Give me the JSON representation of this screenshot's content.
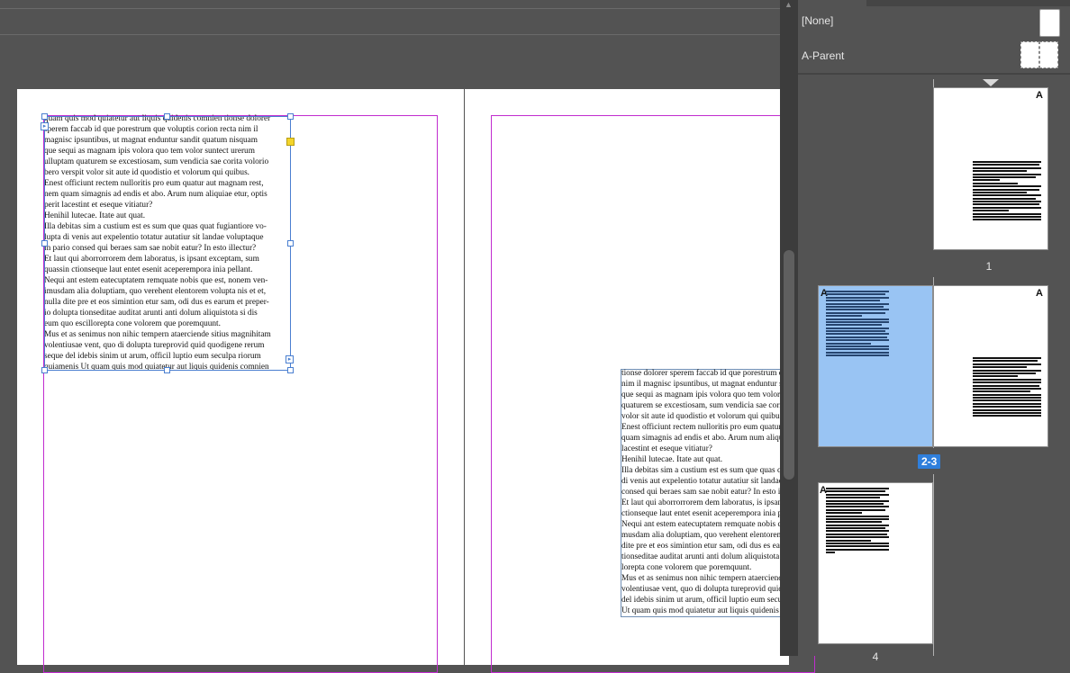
{
  "document": {
    "left_frame_lines": [
      "quam quis mod quiatetur aut liquis quidenis comnien tionse dolorer",
      "sperem faccab id que porestrum que voluptis corion recta nim il",
      "magnisc ipsuntibus, ut magnat enduntur sandit quatum nisquam",
      "que sequi as magnam ipis volora quo tem volor suntect urerum",
      "ulluptam quaturem se excestiosam, sum vendicia sae corita volorio",
      "bero verspit volor sit aute id quodistio et volorum qui quibus.",
      "Enest officiunt rectem nulloritis pro eum quatur aut magnam rest,",
      "nem quam simagnis ad endis et abo. Arum num aliquiae etur, optis",
      "perit lacestint et eseque vitiatur?",
      "Henihil lutecae. Itate aut quat.",
      "Illa debitas sim a custium est es sum que quas quat fugiantiore vo-",
      "lupta di venis aut expelentio totatur autatiur sit landae voluptaque",
      "in pario consed qui beraes sam sae nobit eatur? In esto illectur?",
      "Et laut qui aborrorrorem dem laboratus, is ipsant exceptam, sum",
      "quassin ctionseque laut entet esenit aceperempora inia pellant.",
      "Nequi ant estem eatecuptatem remquate nobis que est, nonem ven-",
      "imusdam alia doluptiam, quo verehent elentorem volupta nis et et,",
      "nulla dite pre et eos simintion etur sam, odi dus es earum et preper-",
      "io dolupta tionseditae auditat arunti anti dolum aliquistota si dis",
      "eum quo escillorepta cone volorem que poremquunt.",
      "Mus et as senimus non nihic tempern ataerciende sitius magnihitam",
      "volentiusae vent, quo di dolupta tureprovid quid quodigene rerum",
      "seque del idebis sinim ut arum, officil luptio eum seculpa riorum",
      "quiamenis Ut quam quis mod quiatetur aut liquis quidenis comnien"
    ],
    "right_frame_lines": [
      "tionse dolorer sperem faccab id que porestrum que voluptis corion recta",
      "nim il magnisc ipsuntibus, ut magnat enduntur sandit quatum nisquam",
      "que sequi as magnam ipis volora quo tem volor suntect urerum ulluptam",
      "quaturem se excestiosam, sum vendicia sae corita volorio bero verspit",
      "volor sit aute id quodistio et volorum qui quibus.",
      "Enest officiunt rectem nulloritis pro eum quatur aut magnam rest, nem",
      "quam simagnis ad endis et abo. Arum num aliquiae etur, optis perit",
      "lacestint et eseque vitiatur?",
      "Henihil lutecae. Itate aut quat.",
      "Illa debitas sim a custium est es sum que quas quat fugiantiore volupta",
      "di venis aut expelentio totatur autatiur sit landae voluptaque in pario",
      "consed qui beraes sam sae nobit eatur? In esto illectur?",
      "Et laut qui aborrorrorem dem laboratus, is ipsant exceptam, sum quassin",
      "ctionseque laut entet esenit aceperempora inia pellant.",
      "Nequi ant estem eatecuptatem remquate nobis que est, nonem ven-",
      "musdam alia doluptiam, quo verehent elentorem volupta nis et et, nulla",
      "dite pre et eos simintion etur sam, odi dus es earum et preperio dolupta",
      "tionseditae auditat arunti anti dolum aliquistota si dis eum quo escil-",
      "lorepta cone volorem que poremquunt.",
      "Mus et as senimus non nihic tempern ataerciende sitius magnihitam",
      "volentiusae vent, quo di dolupta tureprovid quid quodigene rerum seque",
      "del idebis sinim ut arum, officil luptio eum seculpa riorum quiamenis",
      "Ut quam quis mod quiatetur aut liquis quidenis comnien"
    ]
  },
  "pages_panel": {
    "parents": [
      {
        "label": "[None]"
      },
      {
        "label": "A-Parent"
      }
    ],
    "page_prefix": "A",
    "spreads": [
      {
        "label": "1"
      },
      {
        "label": "2-3"
      },
      {
        "label": "4"
      }
    ]
  }
}
